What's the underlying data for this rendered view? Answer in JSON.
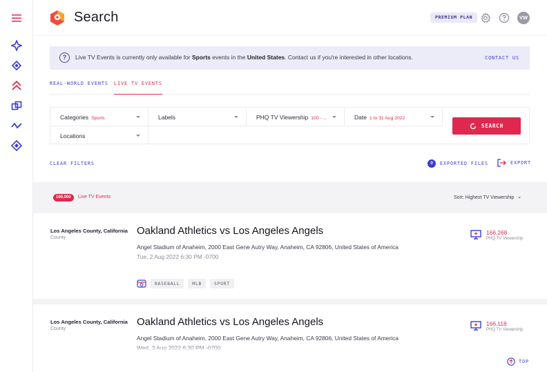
{
  "header": {
    "title": "Search",
    "plan_badge": "PREMIUM PLAN",
    "avatar_initials": "VW"
  },
  "banner": {
    "message_prefix": "Live TV Events is currently only available for ",
    "message_bold_1": "Sports",
    "message_mid": " events in the ",
    "message_bold_2": "United States",
    "message_suffix": ". Contact us if you're interested in other locations.",
    "contact_label": "CONTACT US"
  },
  "tabs": [
    {
      "label": "REAL-WORLD EVENTS",
      "active": false
    },
    {
      "label": "LIVE TV EVENTS",
      "active": true
    }
  ],
  "filters": {
    "categories": {
      "label": "Categories",
      "value": "Sports"
    },
    "labels": {
      "label": "Labels",
      "value": ""
    },
    "viewership": {
      "label": "PHQ TV Viewership",
      "value": "100 - ..."
    },
    "date": {
      "label": "Date",
      "value": "1 to 31 Aug 2022"
    },
    "locations": {
      "label": "Locations",
      "value": ""
    },
    "search_label": "SEARCH"
  },
  "actions": {
    "clear_filters": "CLEAR FILTERS",
    "exported_count": "0",
    "exported_files": "EXPORTED FILES",
    "export": "EXPORT"
  },
  "results": {
    "count": "100,000",
    "count_label": "Live TV Events",
    "sort_label": "Sort: Highest TV Viewership",
    "items": [
      {
        "location": "Los Angeles County, California",
        "location_type": "County",
        "title": "Oakland Athletics vs Los Angeles Angels",
        "address": "Angel Stadium of Anaheim, 2000 East Gene Autry Way, Anaheim, CA 92806, United States of America",
        "datetime": "Tue, 2 Aug 2022 6:30 PM -0700",
        "views": "166,268",
        "views_label": "PHQ TV Viewership",
        "tags": [
          "BASEBALL",
          "MLB",
          "SPORT"
        ]
      },
      {
        "location": "Los Angeles County, California",
        "location_type": "County",
        "title": "Oakland Athletics vs Los Angeles Angels",
        "address": "Angel Stadium of Anaheim, 2000 East Gene Autry Way, Anaheim, CA 92806, United States of America",
        "datetime": "Wed, 3 Aug 2022 6:30 PM -0700",
        "views": "166,118",
        "views_label": "PHQ TV Viewership"
      }
    ]
  },
  "footer": {
    "top_label": "TOP"
  },
  "colors": {
    "accent_pink": "#e0284f",
    "accent_blue": "#3b3bd0"
  },
  "icons": [
    "menu-icon",
    "compass-icon",
    "location-pin-icon",
    "chevrons-up-icon",
    "layers-icon",
    "wave-icon",
    "diamond-icon",
    "settings-icon",
    "help-icon",
    "tv-icon",
    "baseball-icon",
    "refresh-icon",
    "export-icon",
    "arrow-up-icon"
  ]
}
